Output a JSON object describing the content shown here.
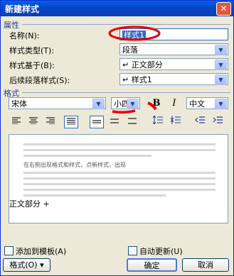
{
  "window": {
    "title": "新建样式",
    "close_glyph": "✕"
  },
  "properties": {
    "section_label": "属性",
    "name_label": "名称(N):",
    "name_value": "样式1",
    "type_label": "样式类型(T):",
    "type_value": "段落",
    "based_on_label": "样式基于(B):",
    "based_on_value": "正文部分",
    "next_label": "后续段落样式(S):",
    "next_value": "样式1"
  },
  "format": {
    "section_label": "格式",
    "font_value": "宋体",
    "size_value": "小四",
    "bold_label": "B",
    "italic_label": "I",
    "lang_value": "中文"
  },
  "preview": {
    "sample_text": "在右侧出现格式和样式，点新样式，出现"
  },
  "description": "正文部分 +",
  "options": {
    "add_template_label": "添加到模板(A)",
    "auto_update_label": "自动更新(U)"
  },
  "buttons": {
    "format_label": "格式(O) ▾",
    "ok_label": "确定",
    "cancel_label": "取消"
  },
  "icons": {
    "align_left": "align-left-icon",
    "center": "align-center-icon",
    "align_right": "align-right-icon",
    "justify": "justify-icon",
    "single_space": "single-spacing-icon",
    "one_half": "one-half-spacing-icon",
    "double": "double-spacing-icon",
    "space_before": "increase-spacing-icon",
    "space_after": "decrease-spacing-icon",
    "dec_indent": "decrease-indent-icon",
    "inc_indent": "increase-indent-icon"
  },
  "colors": {
    "title_bar": "#0a5fe0",
    "annotation": "#e60000",
    "section_text": "#1f3d99"
  }
}
